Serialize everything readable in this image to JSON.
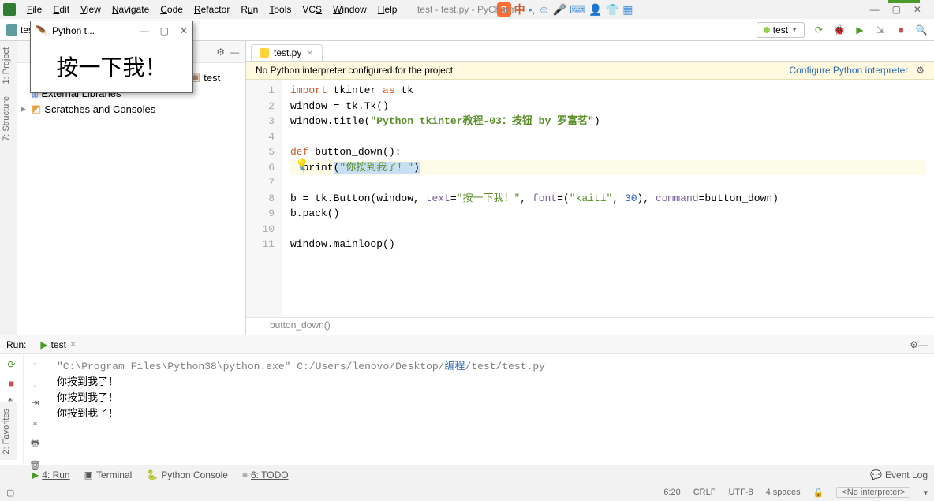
{
  "window_title": "test - test.py - PyCharm",
  "menus": [
    "File",
    "Edit",
    "View",
    "Navigate",
    "Code",
    "Refactor",
    "Run",
    "Tools",
    "VCS",
    "Window",
    "Help"
  ],
  "sogou_cn": "中",
  "breadcrumb": {
    "root": "test",
    "file": "test.py",
    "hidden_folder": "test"
  },
  "run_config": {
    "selected": "test"
  },
  "project_tree": {
    "ext_libs": "External Libraries",
    "scratches": "Scratches and Consoles",
    "test_folder": "test"
  },
  "tabs": {
    "file": "test.py"
  },
  "banner": {
    "msg": "No Python interpreter configured for the project",
    "link": "Configure Python interpreter"
  },
  "code": {
    "line_count": 11,
    "l1a": "import",
    "l1b": "tkinter",
    "l1c": "as",
    "l1d": "tk",
    "l2": "window = tk.Tk()",
    "l3a": "window.title(",
    "l3b": "\"Python tkinter教程-03：按钮 by 罗富茗\"",
    "l3c": ")",
    "l5a": "def",
    "l5b": "button_down():",
    "l6a": "  print",
    "l6b": "(",
    "l6c": "\"你按到我了！\"",
    "l6d": ")",
    "l8a": "b = tk.Button(window, ",
    "l8b": "text",
    "l8c": "=",
    "l8d": "\"按一下我！\"",
    "l8e": ", ",
    "l8f": "font",
    "l8g": "=(",
    "l8h": "\"kaiti\"",
    "l8i": ", ",
    "l8j": "30",
    "l8k": "), ",
    "l8l": "command",
    "l8m": "=button_down)",
    "l9": "b.pack()",
    "l11": "window.mainloop()"
  },
  "crumb_scope": "button_down()",
  "run_panel": {
    "label": "Run:",
    "tab": "test",
    "cmd_a": "\"C:\\Program Files\\Python38\\python.exe\"",
    "cmd_b": " C:/Users/lenovo/Desktop/",
    "cmd_c": "编程",
    "cmd_d": "/test/test.py",
    "out1": "你按到我了！",
    "out2": "你按到我了！",
    "out3": "你按到我了！"
  },
  "bottom": {
    "run": "4: Run",
    "terminal": "Terminal",
    "pyconsole": "Python Console",
    "todo": "6: TODO",
    "eventlog": "Event Log"
  },
  "status": {
    "pos": "6:20",
    "crlf": "CRLF",
    "enc": "UTF-8",
    "indent": "4 spaces",
    "interp": "<No interpreter>"
  },
  "side_tabs": {
    "project": "1: Project",
    "structure": "7: Structure",
    "favorites": "2: Favorites"
  },
  "popup": {
    "title": "Python t...",
    "body": "按一下我！"
  }
}
